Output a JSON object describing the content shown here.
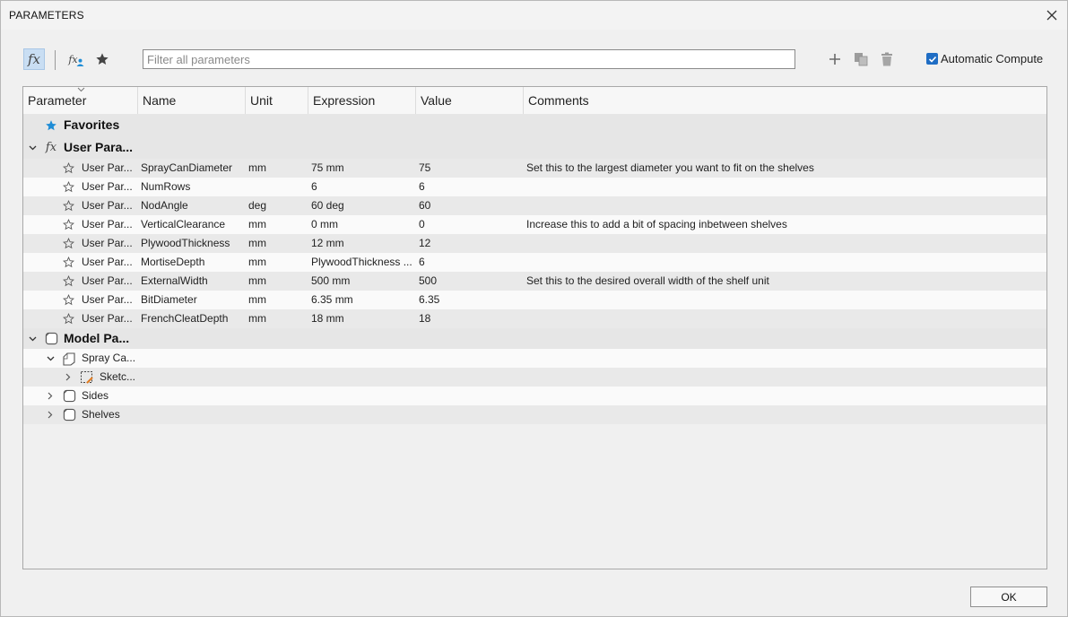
{
  "window": {
    "title": "PARAMETERS"
  },
  "toolbar": {
    "filter_placeholder": "Filter all parameters",
    "filter_value": "",
    "automatic_compute_label": "Automatic Compute",
    "automatic_compute_checked": true,
    "fx_label": "fx",
    "fx_user_label": "fx"
  },
  "columns": [
    "Parameter",
    "Name",
    "Unit",
    "Expression",
    "Value",
    "Comments"
  ],
  "groups": {
    "favorites": "Favorites",
    "user_params": "User Para...",
    "model_params": "Model Pa..."
  },
  "user_parameters": [
    {
      "parameter": "User Par...",
      "name": "SprayCanDiameter",
      "unit": "mm",
      "expression": "75 mm",
      "value": "75",
      "comments": "Set this to the largest diameter you want to fit on the shelves"
    },
    {
      "parameter": "User Par...",
      "name": "NumRows",
      "unit": "",
      "expression": "6",
      "value": "6",
      "comments": ""
    },
    {
      "parameter": "User Par...",
      "name": "NodAngle",
      "unit": "deg",
      "expression": "60 deg",
      "value": "60",
      "comments": ""
    },
    {
      "parameter": "User Par...",
      "name": "VerticalClearance",
      "unit": "mm",
      "expression": "0 mm",
      "value": "0",
      "comments": "Increase this to add a bit of spacing inbetween shelves"
    },
    {
      "parameter": "User Par...",
      "name": "PlywoodThickness",
      "unit": "mm",
      "expression": "12 mm",
      "value": "12",
      "comments": ""
    },
    {
      "parameter": "User Par...",
      "name": "MortiseDepth",
      "unit": "mm",
      "expression": "PlywoodThickness ...",
      "value": "6",
      "comments": ""
    },
    {
      "parameter": "User Par...",
      "name": "ExternalWidth",
      "unit": "mm",
      "expression": "500 mm",
      "value": "500",
      "comments": "Set this to the desired overall width of the shelf unit"
    },
    {
      "parameter": "User Par...",
      "name": "BitDiameter",
      "unit": "mm",
      "expression": "6.35 mm",
      "value": "6.35",
      "comments": ""
    },
    {
      "parameter": "User Par...",
      "name": "FrenchCleatDepth",
      "unit": "mm",
      "expression": "18 mm",
      "value": "18",
      "comments": ""
    }
  ],
  "model_tree": {
    "spray_can": "Spray Ca...",
    "sketch": "Sketc...",
    "sides": "Sides",
    "shelves": "Shelves"
  },
  "footer": {
    "ok_label": "OK"
  },
  "colors": {
    "accent": "#1f8dd6",
    "checkbox": "#1f6dc4"
  },
  "icons": {
    "favorites": "star-filled-icon",
    "row_favorite": "star-outline-icon",
    "add": "plus-icon",
    "copy": "copy-icon",
    "delete": "trash-icon",
    "close": "close-icon"
  }
}
